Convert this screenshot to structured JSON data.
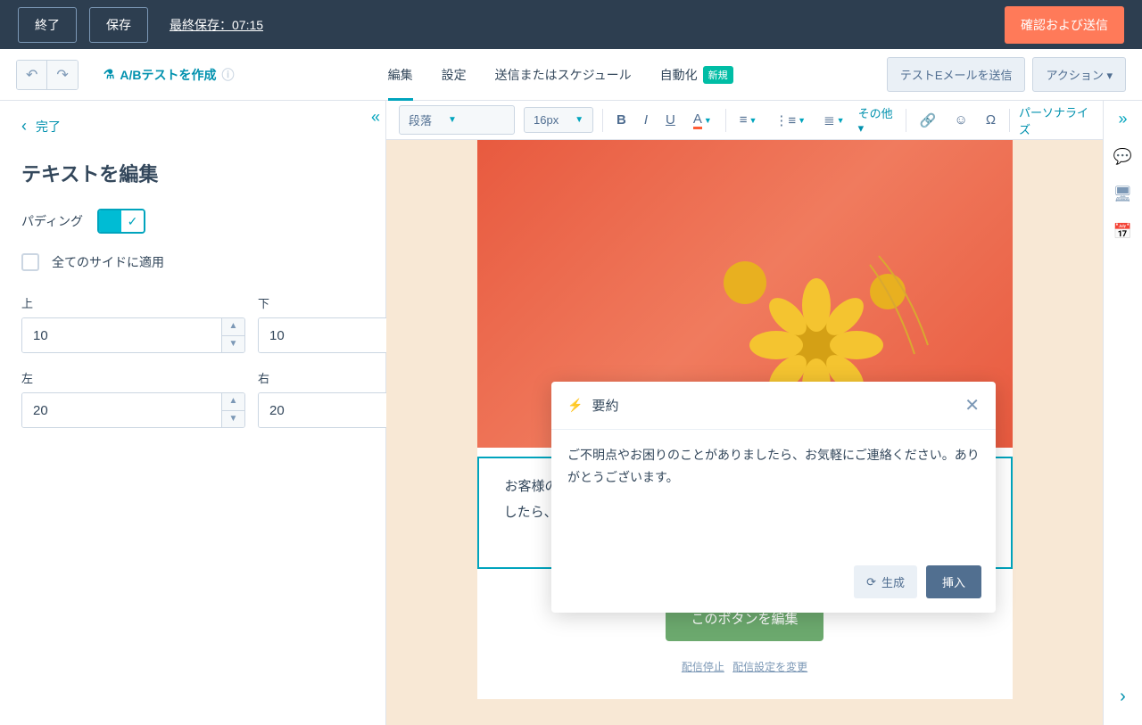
{
  "topbar": {
    "exit": "終了",
    "save": "保存",
    "last_saved": "最終保存：07:15",
    "confirm_send": "確認および送信"
  },
  "subbar": {
    "ab_test": "A/Bテストを作成",
    "tabs": {
      "edit": "編集",
      "settings": "設定",
      "send": "送信またはスケジュール",
      "automation": "自動化"
    },
    "new_badge": "新規",
    "test_email": "テストEメールを送信",
    "actions": "アクション"
  },
  "panel": {
    "back": "完了",
    "title": "テキストを編集",
    "padding_label": "パディング",
    "apply_all": "全てのサイドに適用",
    "top": "上",
    "bottom": "下",
    "left": "左",
    "right": "右",
    "top_val": "10",
    "bottom_val": "10",
    "left_val": "20",
    "right_val": "20"
  },
  "toolbar": {
    "paragraph": "段落",
    "font_size": "16px",
    "other": "その他",
    "personalize": "パーソナライズ"
  },
  "email": {
    "text_block": "お客様のお困り事やご質問をいつでも受け付けております。ご不明点がございましたら、お気軽にご連絡ください。また、ご利用いただき誠にありがとうございます。",
    "cta": "このボタンを編集",
    "unsubscribe": "配信停止",
    "preferences": "配信設定を変更"
  },
  "popup": {
    "title": "要約",
    "body": "ご不明点やお困りのことがありましたら、お気軽にご連絡ください。ありがとうございます。",
    "regenerate": "生成",
    "insert": "挿入"
  }
}
